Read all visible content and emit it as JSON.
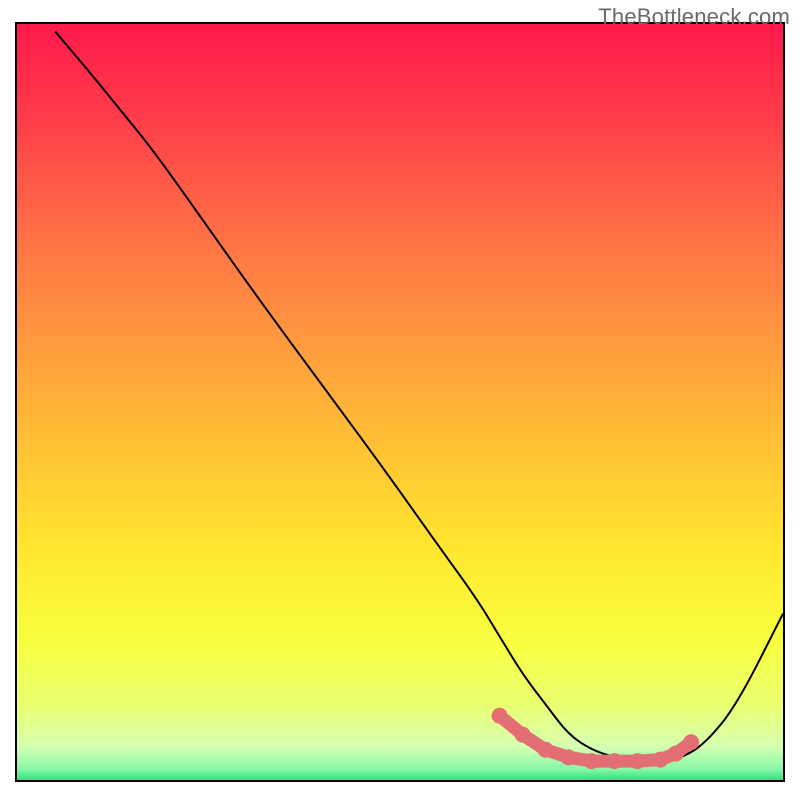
{
  "watermark": "TheBottleneck.com",
  "gradient": {
    "stops": [
      {
        "offset": 0.0,
        "color": "#ff1a4b"
      },
      {
        "offset": 0.12,
        "color": "#ff3b4a"
      },
      {
        "offset": 0.26,
        "color": "#ff6a46"
      },
      {
        "offset": 0.4,
        "color": "#ff9440"
      },
      {
        "offset": 0.55,
        "color": "#ffbf35"
      },
      {
        "offset": 0.7,
        "color": "#ffe82f"
      },
      {
        "offset": 0.82,
        "color": "#f8ff40"
      },
      {
        "offset": 0.9,
        "color": "#eaff70"
      },
      {
        "offset": 0.955,
        "color": "#d6ffb0"
      },
      {
        "offset": 0.985,
        "color": "#8cf7a8"
      },
      {
        "offset": 1.0,
        "color": "#2de57f"
      }
    ]
  },
  "chart_data": {
    "type": "line",
    "title": "",
    "xlabel": "",
    "ylabel": "",
    "xlim": [
      0,
      100
    ],
    "ylim": [
      0,
      100
    ],
    "series": [
      {
        "name": "bottleneck-curve",
        "color": "#000000",
        "x": [
          5,
          10,
          14,
          18,
          25,
          32,
          40,
          48,
          55,
          60,
          63,
          66,
          69,
          72,
          75,
          78,
          81,
          84,
          87,
          90,
          94,
          100
        ],
        "y": [
          99,
          93,
          88,
          83,
          73,
          63,
          52,
          41,
          31,
          24,
          19,
          14,
          10,
          6,
          4,
          3,
          2.5,
          2.5,
          3,
          5,
          10,
          22
        ]
      }
    ],
    "highlight": {
      "name": "optimal-zone",
      "color": "#e36f75",
      "points": [
        {
          "x": 63,
          "y": 8.5
        },
        {
          "x": 66,
          "y": 6.0
        },
        {
          "x": 69,
          "y": 4.0
        },
        {
          "x": 72,
          "y": 3.0
        },
        {
          "x": 75,
          "y": 2.5
        },
        {
          "x": 78,
          "y": 2.5
        },
        {
          "x": 81,
          "y": 2.5
        },
        {
          "x": 84,
          "y": 2.7
        },
        {
          "x": 86,
          "y": 3.5
        },
        {
          "x": 88,
          "y": 5.0
        }
      ]
    }
  }
}
